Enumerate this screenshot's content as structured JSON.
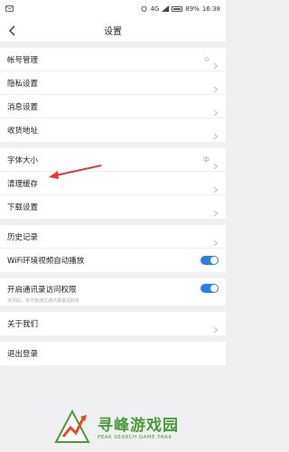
{
  "status_bar": {
    "network": "4G",
    "battery": "89%",
    "time": "16:38"
  },
  "header": {
    "title": "设置"
  },
  "groups": [
    {
      "items": [
        {
          "label": "帐号管理",
          "value": "⊙",
          "type": "link"
        },
        {
          "label": "隐私设置",
          "type": "link"
        },
        {
          "label": "消息设置",
          "type": "link"
        },
        {
          "label": "收货地址",
          "type": "link"
        }
      ]
    },
    {
      "items": [
        {
          "label": "字体大小",
          "value": "中",
          "type": "link"
        },
        {
          "label": "清理缓存",
          "type": "link"
        },
        {
          "label": "下载设置",
          "type": "link"
        }
      ]
    },
    {
      "items": [
        {
          "label": "历史记录",
          "type": "link"
        },
        {
          "label": "WiFi环境视频自动播放",
          "type": "toggle",
          "on": true
        }
      ]
    },
    {
      "items": [
        {
          "label": "开启通讯录访问权限",
          "sub": "关闭后，将不能通过通讯录邀请好友",
          "type": "toggle",
          "on": true
        }
      ]
    },
    {
      "items": [
        {
          "label": "关于我们",
          "type": "link"
        }
      ]
    },
    {
      "items": [
        {
          "label": "退出登录",
          "type": "action"
        }
      ]
    }
  ],
  "watermark": {
    "name": "寻峰游戏园",
    "tagline": "PEAK SEARCH GAME PARK"
  },
  "colors": {
    "accent": "#2f7fe0",
    "annotation_arrow": "#e23a3a",
    "watermark": "#4a9a3c"
  }
}
